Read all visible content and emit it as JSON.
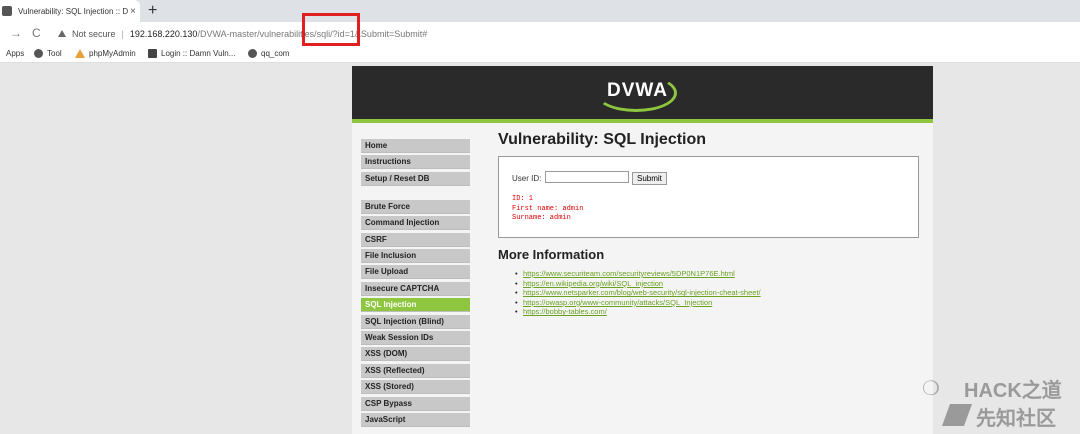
{
  "browser": {
    "tab_title": "Vulnerability: SQL Injection :: Dam",
    "tab_close": "×",
    "new_tab": "+",
    "back": "→",
    "reload": "C",
    "security_label": "Not secure",
    "separator": "|",
    "url_host": "192.168.220.130",
    "url_path": "/DVWA-master/vulnerabilities/sqli/?id=1&Submit=Submit#",
    "bookmarks": [
      "Apps",
      "Tool",
      "phpMyAdmin",
      "Login :: Damn Vuln...",
      "qq_com"
    ]
  },
  "dvwa": {
    "logo": "DVWA",
    "menu": [
      "Home",
      "Instructions",
      "Setup / Reset DB",
      "Brute Force",
      "Command Injection",
      "CSRF",
      "File Inclusion",
      "File Upload",
      "Insecure CAPTCHA",
      "SQL Injection",
      "SQL Injection (Blind)",
      "Weak Session IDs",
      "XSS (DOM)",
      "XSS (Reflected)",
      "XSS (Stored)",
      "CSP Bypass",
      "JavaScript"
    ],
    "active_menu": "SQL Injection",
    "title": "Vulnerability: SQL Injection",
    "form": {
      "label": "User ID:",
      "input_value": "",
      "submit": "Submit"
    },
    "result": [
      "ID: 1",
      "First name: admin",
      "Surname: admin"
    ],
    "more_title": "More Information",
    "links": [
      "https://www.securiteam.com/securityreviews/5DP0N1P76E.html",
      "https://en.wikipedia.org/wiki/SQL_injection",
      "https://www.netsparker.com/blog/web-security/sql-injection-cheat-sheet/",
      "https://owasp.org/www-community/attacks/SQL_Injection",
      "https://bobby-tables.com/"
    ]
  },
  "watermark": {
    "title": "HACK之道",
    "subtitle": "先知社区"
  }
}
